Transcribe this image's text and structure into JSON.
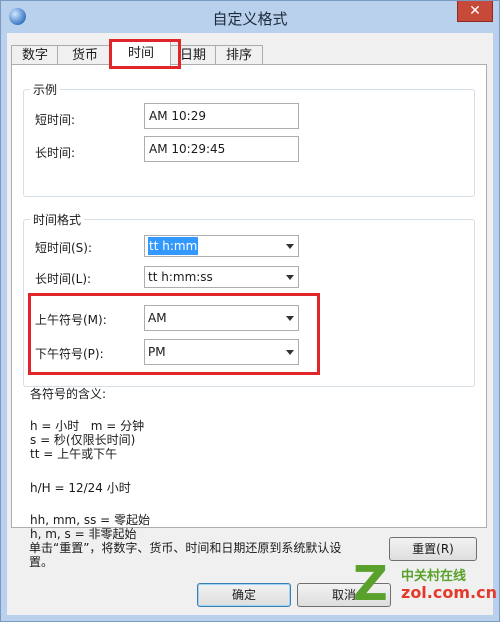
{
  "window": {
    "title": "自定义格式",
    "close_glyph": "✕"
  },
  "tabs": [
    {
      "label": "数字"
    },
    {
      "label": "货币"
    },
    {
      "label": "时间",
      "selected": true
    },
    {
      "label": "日期"
    },
    {
      "label": "排序"
    }
  ],
  "example": {
    "legend": "示例",
    "short_label": "短时间:",
    "short_value": "AM 10:29",
    "long_label": "长时间:",
    "long_value": "AM 10:29:45"
  },
  "formats": {
    "legend": "时间格式",
    "short_label": "短时间(S):",
    "short_value": "tt h:mm",
    "long_label": "长时间(L):",
    "long_value": "tt h:mm:ss",
    "am_label": "上午符号(M):",
    "am_value": "AM",
    "pm_label": "下午符号(P):",
    "pm_value": "PM"
  },
  "legend_notes": {
    "heading": "各符号的含义:",
    "line1": "h = 小时   m = 分钟",
    "line2": "s = 秒(仅限长时间)",
    "line3": "tt = 上午或下午",
    "line4": "h/H = 12/24 小时",
    "line5": "hh, mm, ss = 零起始",
    "line6": "h, m, s = 非零起始"
  },
  "reset": {
    "text_line1": "单击“重置”，将数字、货币、时间和日期还原到系统默认设",
    "text_line2": "置。",
    "button": "重置(R)"
  },
  "footer": {
    "ok": "确定",
    "cancel": "取消"
  },
  "watermark": {
    "brand": "中关村在线",
    "url": "zol.com.cn",
    "logo_letter": "Z"
  },
  "colors": {
    "highlight_box": "#e0262b",
    "selection": "#3399ff"
  }
}
